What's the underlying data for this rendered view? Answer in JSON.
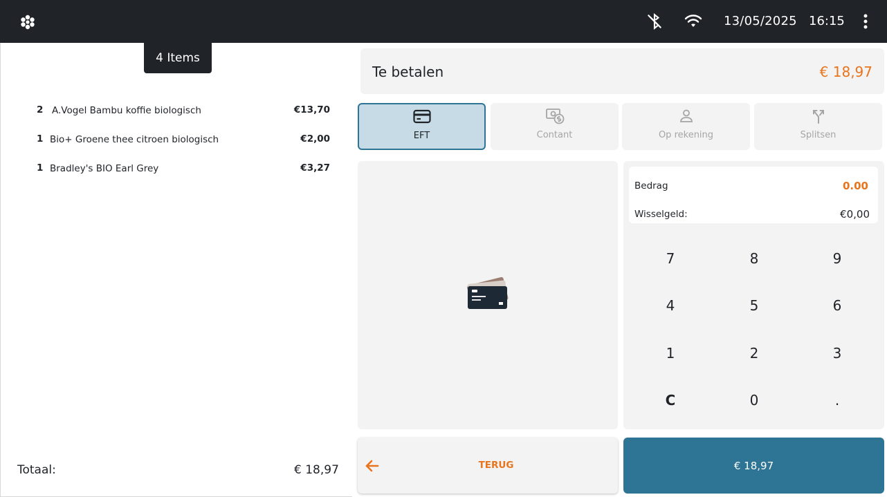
{
  "topbar": {
    "logo_icon": "flower-logo-icon",
    "bluetooth_icon": "bluetooth-off-icon",
    "wifi_icon": "wifi-icon",
    "date": "13/05/2025",
    "time": "16:15",
    "menu_icon": "more-vertical-icon"
  },
  "cart": {
    "badge": "4 Items",
    "items": [
      {
        "qty": "2",
        "name": "A.Vogel Bambu koffie biologisch",
        "price": "€13,70"
      },
      {
        "qty": "1",
        "name": "Bio+ Groene thee citroen biologisch",
        "price": "€2,00"
      },
      {
        "qty": "1",
        "name": "Bradley's BIO Earl Grey",
        "price": "€3,27"
      }
    ],
    "total_label": "Totaal:",
    "total_value": "€ 18,97"
  },
  "payment": {
    "to_pay_label": "Te betalen",
    "to_pay_amount": "€ 18,97",
    "methods": [
      {
        "label": "EFT",
        "icon": "credit-card-icon",
        "active": true
      },
      {
        "label": "Contant",
        "icon": "cash-icon",
        "active": false
      },
      {
        "label": "Op rekening",
        "icon": "user-icon",
        "active": false
      },
      {
        "label": "Splitsen",
        "icon": "split-icon",
        "active": false
      }
    ],
    "terminal_icon": "payment-cards-icon"
  },
  "keypad": {
    "bedrag_label": "Bedrag",
    "bedrag_value": "0.00",
    "wisselgeld_label": "Wisselgeld:",
    "wisselgeld_value": "€0,00",
    "keys": [
      "7",
      "8",
      "9",
      "4",
      "5",
      "6",
      "1",
      "2",
      "3",
      "C",
      "0",
      "."
    ]
  },
  "actions": {
    "back_label": "TERUG",
    "back_icon": "arrow-left-icon",
    "pay_label": "€ 18,97"
  },
  "colors": {
    "accent_orange": "#e8741c",
    "primary_blue": "#2d7495",
    "topbar": "#202328"
  }
}
